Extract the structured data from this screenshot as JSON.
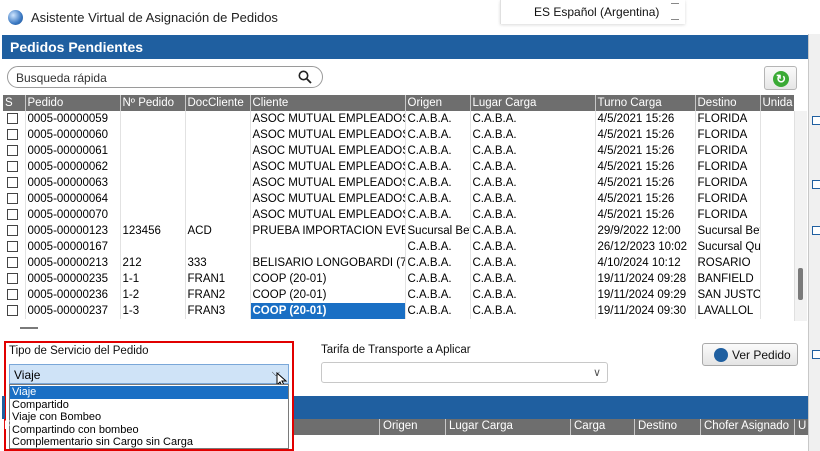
{
  "window": {
    "title": "Asistente Virtual de Asignación de Pedidos",
    "language": "ES Español (Argentina)"
  },
  "header": {
    "title": "Pedidos Pendientes"
  },
  "search": {
    "placeholder": "Busqueda rápida"
  },
  "grid": {
    "columns": [
      "S",
      "Pedido",
      "Nº Pedido",
      "DocCliente",
      "Cliente",
      "Origen",
      "Lugar Carga",
      "Turno Carga",
      "Destino",
      "Unida"
    ],
    "rows": [
      [
        "",
        "0005-00000059",
        "",
        "",
        "ASOC MUTUAL EMPLEADOS de",
        "C.A.B.A.",
        "C.A.B.A.",
        "4/5/2021 15:26",
        "FLORIDA",
        ""
      ],
      [
        "",
        "0005-00000060",
        "",
        "",
        "ASOC MUTUAL EMPLEADOS de",
        "C.A.B.A.",
        "C.A.B.A.",
        "4/5/2021 15:26",
        "FLORIDA",
        ""
      ],
      [
        "",
        "0005-00000061",
        "",
        "",
        "ASOC MUTUAL EMPLEADOS de",
        "C.A.B.A.",
        "C.A.B.A.",
        "4/5/2021 15:26",
        "FLORIDA",
        ""
      ],
      [
        "",
        "0005-00000062",
        "",
        "",
        "ASOC MUTUAL EMPLEADOS de",
        "C.A.B.A.",
        "C.A.B.A.",
        "4/5/2021 15:26",
        "FLORIDA",
        ""
      ],
      [
        "",
        "0005-00000063",
        "",
        "",
        "ASOC MUTUAL EMPLEADOS de",
        "C.A.B.A.",
        "C.A.B.A.",
        "4/5/2021 15:26",
        "FLORIDA",
        ""
      ],
      [
        "",
        "0005-00000064",
        "",
        "",
        "ASOC MUTUAL EMPLEADOS de",
        "C.A.B.A.",
        "C.A.B.A.",
        "4/5/2021 15:26",
        "FLORIDA",
        ""
      ],
      [
        "",
        "0005-00000070",
        "",
        "",
        "ASOC MUTUAL EMPLEADOS de",
        "C.A.B.A.",
        "C.A.B.A.",
        "4/5/2021 15:26",
        "FLORIDA",
        ""
      ],
      [
        "",
        "0005-00000123",
        "123456",
        "ACD",
        "PRUEBA IMPORTACION EVEN (1",
        "Sucursal Beta",
        "C.A.B.A.",
        "29/9/2022 12:00",
        "Sucursal Beta",
        ""
      ],
      [
        "",
        "0005-00000167",
        "",
        "",
        "",
        "C.A.B.A.",
        "C.A.B.A.",
        "26/12/2023 10:02",
        "Sucursal Quilmes",
        ""
      ],
      [
        "",
        "0005-00000213",
        "212",
        "333",
        "BELISARIO LONGOBARDI (7-01)",
        "C.A.B.A.",
        "C.A.B.A.",
        "4/10/2024 10:12",
        "ROSARIO",
        ""
      ],
      [
        "",
        "0005-00000235",
        "1-1",
        "FRAN1",
        "COOP (20-01)",
        "C.A.B.A.",
        "C.A.B.A.",
        "19/11/2024 09:28",
        "BANFIELD",
        ""
      ],
      [
        "",
        "0005-00000236",
        "1-2",
        "FRAN2",
        "COOP (20-01)",
        "C.A.B.A.",
        "C.A.B.A.",
        "19/11/2024 09:29",
        "SAN JUSTO",
        ""
      ],
      [
        "",
        "0005-00000237",
        "1-3",
        "FRAN3",
        "COOP (20-01)",
        "C.A.B.A.",
        "C.A.B.A.",
        "19/11/2024 09:30",
        "LAVALLOL",
        ""
      ]
    ],
    "selected_cell": {
      "row": 12,
      "column": "Cliente"
    }
  },
  "form": {
    "tipo_label": "Tipo de Servicio del Pedido",
    "tipo_value": "Viaje",
    "tipo_options": [
      "Viaje",
      "Compartido",
      "Viaje con Bombeo",
      "Compartindo con bombeo",
      "Complementario sin Cargo sin Carga"
    ],
    "tarifa_label": "Tarifa de Transporte a Aplicar",
    "tarifa_value": "",
    "ver_pedido_label": "Ver Pedido"
  },
  "lower_grid": {
    "columns": [
      "F",
      "Origen",
      "Lugar Carga",
      "Carga",
      "Destino",
      "Chofer Asignado",
      "U"
    ]
  },
  "icons": {
    "search": "search-icon",
    "refresh": "refresh-icon",
    "view": "magnifier-icon",
    "app": "globe-icon"
  },
  "colors": {
    "header_blue": "#1f5fa0",
    "column_header_gray": "#6e6e6e",
    "selection_blue": "#1a6fc4",
    "highlight_red": "#e10000"
  }
}
